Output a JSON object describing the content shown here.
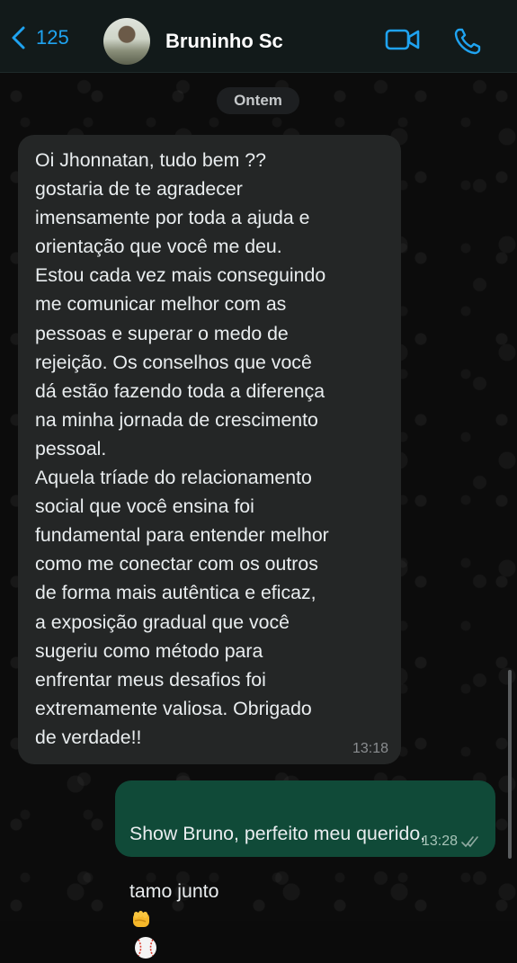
{
  "header": {
    "back_count": "125",
    "contact_name": "Bruninho Sc"
  },
  "chat": {
    "date_label": "Ontem",
    "incoming": {
      "text": "Oi Jhonnatan, tudo bem ??\ngostaria de te agradecer\nimensamente por toda a ajuda e\norientação que você me deu.\nEstou cada vez mais conseguindo\nme comunicar melhor com as\npessoas e superar o medo de\nrejeição. Os conselhos que você\ndá estão fazendo toda a diferença\nna minha jornada de crescimento\npessoal.\nAquela tríade do relacionamento\nsocial que você ensina foi\nfundamental para entender melhor\ncomo me conectar com os outros\nde forma mais autêntica e eficaz,\na exposição gradual que você\nsugeriu como método para\nenfrentar meus desafios foi\nextremamente valiosa. Obrigado\nde verdade!!",
      "time": "13:18"
    },
    "outgoing": {
      "text_line1": "Show Bruno, perfeito meu querido,",
      "text_line2": "tamo junto",
      "time": "13:28",
      "status": "read"
    }
  },
  "colors": {
    "accent": "#1fa3f0",
    "incoming_bubble": "#242626",
    "outgoing_bubble": "#104a38",
    "read_ticks": "#8fa9a0"
  },
  "icons": [
    "chevron-left-icon",
    "video-call-icon",
    "phone-icon",
    "fist-emoji-icon",
    "baseball-emoji-icon",
    "double-check-icon"
  ]
}
